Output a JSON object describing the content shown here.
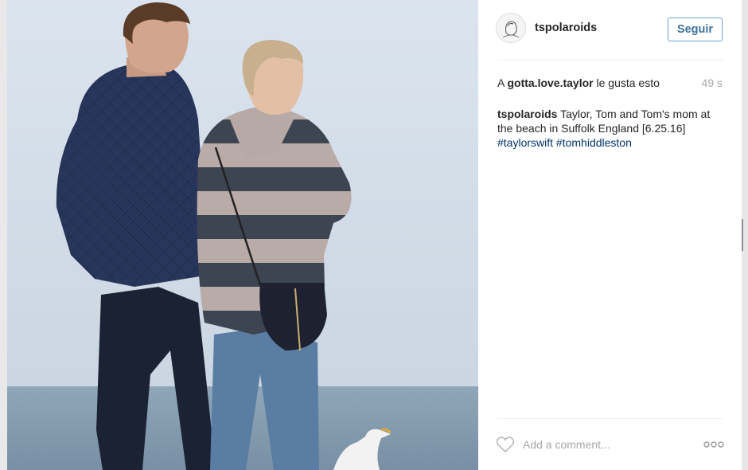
{
  "post": {
    "username": "tspolaroids",
    "follow_label": "Seguir",
    "likes": {
      "prefix": "A",
      "liker": "gotta.love.taylor",
      "suffix": "le gusta esto"
    },
    "time": "49 s",
    "caption": {
      "author": "tspolaroids",
      "text": "Taylor, Tom and Tom's mom at the beach in Suffolk England [6.25.16]",
      "hashtags": [
        "#taylorswift",
        "#tomhiddleston"
      ]
    },
    "comment_placeholder": "Add a comment...",
    "icons": {
      "like": "heart-icon",
      "more": "more-options-icon",
      "avatar": "avatar-icon"
    }
  },
  "colors": {
    "link_blue": "#003569",
    "follow_blue": "#3f729b",
    "muted_gray": "#a5a7aa",
    "text": "#262626"
  }
}
